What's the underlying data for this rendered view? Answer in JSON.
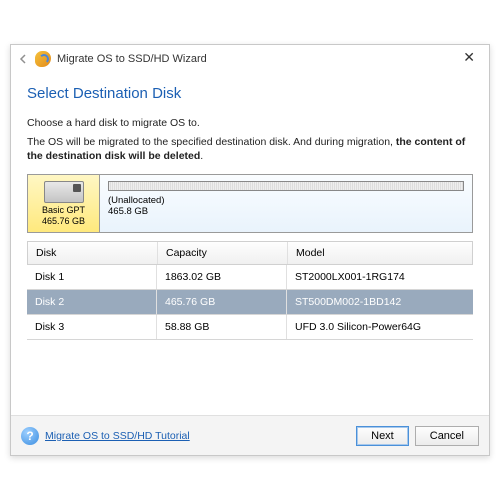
{
  "window": {
    "title": "Migrate OS to SSD/HD Wizard"
  },
  "page": {
    "heading": "Select Destination Disk",
    "instruction1": "Choose a hard disk to migrate OS to.",
    "instruction2_pre": "The OS will be migrated to the specified destination disk. And during migration, ",
    "instruction2_bold": "the content of the destination disk will be deleted",
    "instruction2_post": "."
  },
  "selected_disk": {
    "type": "Basic GPT",
    "size": "465.76 GB",
    "partition_label": "(Unallocated)",
    "partition_size": "465.8 GB"
  },
  "table": {
    "headers": {
      "disk": "Disk",
      "capacity": "Capacity",
      "model": "Model"
    },
    "rows": [
      {
        "disk": "Disk 1",
        "capacity": "1863.02 GB",
        "model": "ST2000LX001-1RG174",
        "selected": false
      },
      {
        "disk": "Disk 2",
        "capacity": "465.76 GB",
        "model": "ST500DM002-1BD142",
        "selected": true
      },
      {
        "disk": "Disk 3",
        "capacity": "58.88 GB",
        "model": "UFD 3.0 Silicon-Power64G",
        "selected": false
      }
    ]
  },
  "footer": {
    "tutorial": "Migrate OS to SSD/HD Tutorial",
    "next": "Next",
    "cancel": "Cancel"
  }
}
